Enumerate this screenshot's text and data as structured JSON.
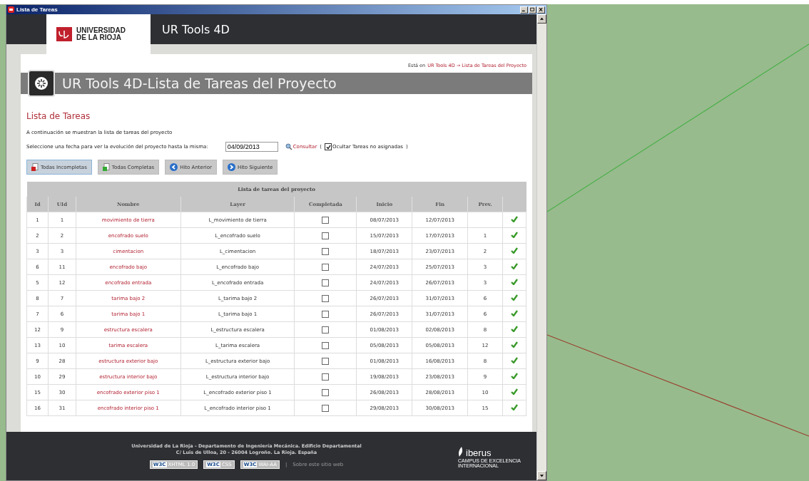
{
  "window": {
    "title": "Lista de Tareas"
  },
  "header": {
    "logo_lines": [
      "UNIVERSIDAD",
      "DE LA RIOJA"
    ],
    "app_title": "UR Tools 4D"
  },
  "breadcrumb": {
    "prefix": "Está en",
    "link": "UR Tools 4D → Lista de Tareas del Proyecto"
  },
  "page_title": "UR Tools 4D-Lista de Tareas del Proyecto",
  "section_heading": "Lista de Tareas",
  "intro": "A continuación se muestran la lista de tareas del proyecto",
  "date_filter": {
    "prompt": "Seleccione una fecha para ver la evolución del proyecto hasta la misma:",
    "value": "04/09/2013",
    "consult_link": "Consultar",
    "open_paren": "(",
    "hide_unassigned": {
      "label": "Ocultar Tareas no asignadas",
      "checked": true
    },
    "close_paren": ")"
  },
  "buttons": [
    {
      "label": "Todas Incompletas",
      "kind": "doc-red",
      "selected": true
    },
    {
      "label": "Todas Completas",
      "kind": "doc-green",
      "selected": false
    },
    {
      "label": "Hito Anterior",
      "kind": "prev",
      "selected": false
    },
    {
      "label": "Hito Siguiente",
      "kind": "next",
      "selected": false
    }
  ],
  "table": {
    "caption": "Lista de tareas del proyecto",
    "columns": [
      "Id",
      "UId",
      "Nombre",
      "Layer",
      "Completada",
      "Inicio",
      "Fin",
      "Prev."
    ],
    "rows": [
      {
        "id": "1",
        "uid": "1",
        "name": "movimiento de tierra",
        "layer": "L_movimiento de tierra",
        "completed": false,
        "start": "08/07/2013",
        "end": "12/07/2013",
        "valid": true
      },
      {
        "id": "2",
        "uid": "2",
        "name": "encofrado suelo",
        "layer": "L_encofrado suelo",
        "completed": false,
        "start": "15/07/2013",
        "end": "17/07/2013",
        "prev": "1",
        "valid": true
      },
      {
        "id": "3",
        "uid": "3",
        "name": "cimentacion",
        "layer": "L_cimentacion",
        "completed": false,
        "start": "18/07/2013",
        "end": "23/07/2013",
        "prev": "2",
        "valid": true
      },
      {
        "id": "6",
        "uid": "11",
        "name": "encofrado bajo",
        "layer": "L_encofrado bajo",
        "completed": false,
        "start": "24/07/2013",
        "end": "25/07/2013",
        "prev": "3",
        "valid": true
      },
      {
        "id": "5",
        "uid": "12",
        "name": "encofrado entrada",
        "layer": "L_encofrado entrada",
        "completed": false,
        "start": "24/07/2013",
        "end": "26/07/2013",
        "prev": "3",
        "valid": true
      },
      {
        "id": "8",
        "uid": "7",
        "name": "tarima bajo 2",
        "layer": "L_tarima bajo 2",
        "completed": false,
        "start": "26/07/2013",
        "end": "31/07/2013",
        "prev": "6",
        "valid": true
      },
      {
        "id": "7",
        "uid": "6",
        "name": "tarima bajo 1",
        "layer": "L_tarima bajo 1",
        "completed": false,
        "start": "26/07/2013",
        "end": "31/07/2013",
        "prev": "6",
        "valid": true
      },
      {
        "id": "12",
        "uid": "9",
        "name": "estructura escalera",
        "layer": "L_estructura escalera",
        "completed": false,
        "start": "01/08/2013",
        "end": "02/08/2013",
        "prev": "8",
        "valid": true
      },
      {
        "id": "13",
        "uid": "10",
        "name": "tarima escalera",
        "layer": "L_tarima escalera",
        "completed": false,
        "start": "05/08/2013",
        "end": "05/08/2013",
        "prev": "12",
        "valid": true
      },
      {
        "id": "9",
        "uid": "28",
        "name": "estructura exterior bajo",
        "layer": "L_estructura exterior bajo",
        "completed": false,
        "start": "01/08/2013",
        "end": "16/08/2013",
        "prev": "8",
        "valid": true
      },
      {
        "id": "10",
        "uid": "29",
        "name": "estructura interior bajo",
        "layer": "L_estructura interior bajo",
        "completed": false,
        "start": "19/08/2013",
        "end": "23/08/2013",
        "prev": "9",
        "valid": true
      },
      {
        "id": "15",
        "uid": "30",
        "name": "encofrado exterior piso 1",
        "layer": "L_encofrado exterior piso 1",
        "completed": false,
        "start": "26/08/2013",
        "end": "28/08/2013",
        "prev": "10",
        "valid": true
      },
      {
        "id": "16",
        "uid": "31",
        "name": "encofrado interior piso 1",
        "layer": "L_encofrado interior piso 1",
        "completed": false,
        "start": "29/08/2013",
        "end": "30/08/2013",
        "prev": "15",
        "valid": true
      }
    ]
  },
  "footer": {
    "lines": [
      "Universidad de La Rioja - Departamento de Ingeniería Mecánica. Edificio Departamental",
      "C/ Luis de Ulloa, 20 - 26004 Logroño. La Rioja. España"
    ],
    "badges": [
      {
        "mark": "W3C",
        "label": "XHTML 1.0"
      },
      {
        "mark": "W3C",
        "label": "CSS"
      },
      {
        "mark": "W3C",
        "label": "WAI-AA"
      }
    ],
    "separator": "|",
    "about_link": "Sobre este sitio web",
    "partner": {
      "name": "iberus",
      "lines": [
        "CAMPUS DE EXCELENCIA",
        "INTERNACIONAL"
      ]
    }
  }
}
